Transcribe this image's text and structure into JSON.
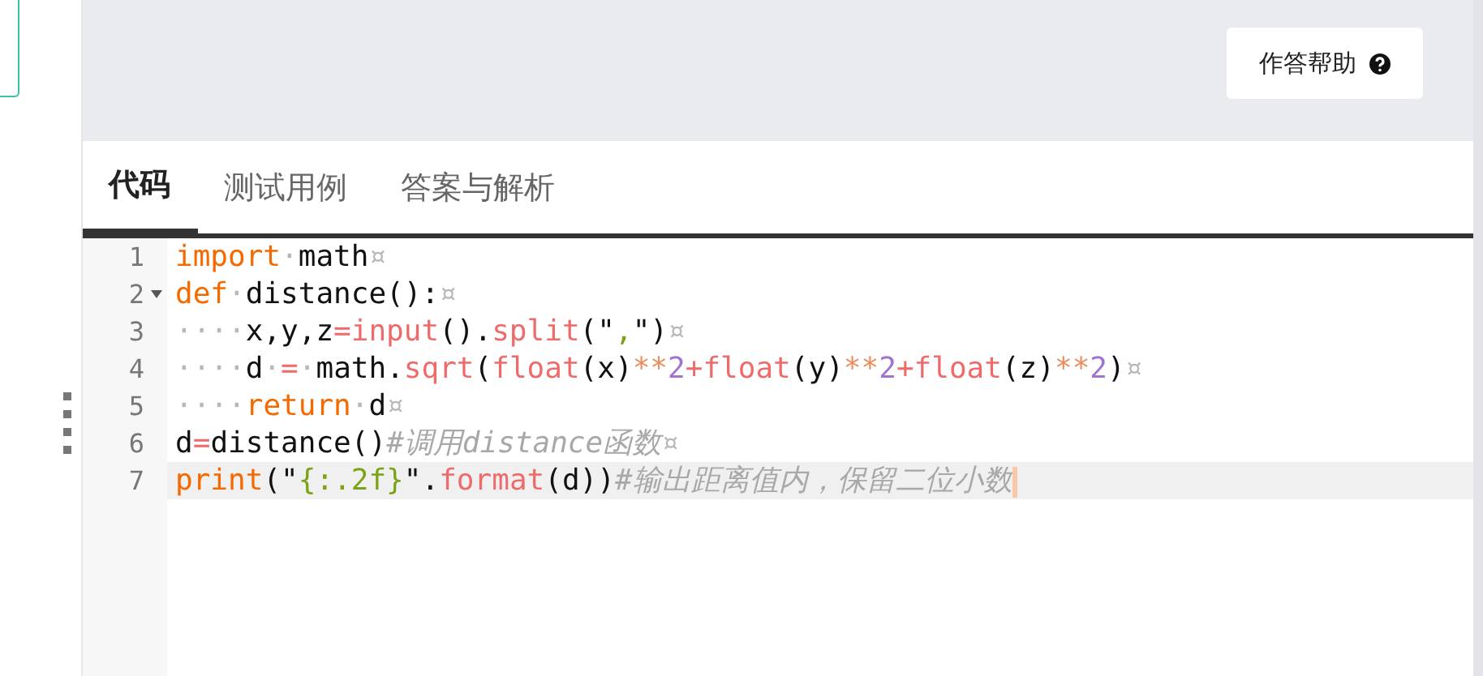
{
  "help_button": {
    "label": "作答帮助"
  },
  "tabs": [
    {
      "label": "代码",
      "selected": true
    },
    {
      "label": "测试用例",
      "selected": false
    },
    {
      "label": "答案与解析",
      "selected": false
    }
  ],
  "editor": {
    "lines": [
      {
        "number": "1",
        "fold": false,
        "active": false,
        "tokens": [
          {
            "kind": "keyword",
            "text": "import"
          },
          {
            "kind": "invisible",
            "text": "·"
          },
          {
            "kind": "plain",
            "text": "math"
          },
          {
            "kind": "invisible",
            "text": "¤"
          }
        ]
      },
      {
        "number": "2",
        "fold": true,
        "active": false,
        "tokens": [
          {
            "kind": "keyword",
            "text": "def"
          },
          {
            "kind": "invisible",
            "text": "·"
          },
          {
            "kind": "plain",
            "text": "distance():"
          },
          {
            "kind": "invisible",
            "text": "¤"
          }
        ]
      },
      {
        "number": "3",
        "fold": false,
        "active": false,
        "tokens": [
          {
            "kind": "invisible",
            "text": "····"
          },
          {
            "kind": "plain",
            "text": "x,y,z"
          },
          {
            "kind": "func",
            "text": "=input"
          },
          {
            "kind": "plain",
            "text": "()."
          },
          {
            "kind": "func",
            "text": "split"
          },
          {
            "kind": "plain",
            "text": "(\""
          },
          {
            "kind": "string",
            "text": ","
          },
          {
            "kind": "plain",
            "text": "\")"
          },
          {
            "kind": "invisible",
            "text": "¤"
          }
        ]
      },
      {
        "number": "4",
        "fold": false,
        "active": false,
        "tokens": [
          {
            "kind": "invisible",
            "text": "····"
          },
          {
            "kind": "plain",
            "text": "d"
          },
          {
            "kind": "invisible",
            "text": "·"
          },
          {
            "kind": "func",
            "text": "="
          },
          {
            "kind": "invisible",
            "text": "·"
          },
          {
            "kind": "plain",
            "text": "math."
          },
          {
            "kind": "func",
            "text": "sqrt"
          },
          {
            "kind": "plain",
            "text": "("
          },
          {
            "kind": "func",
            "text": "float"
          },
          {
            "kind": "plain",
            "text": "(x)"
          },
          {
            "kind": "operator",
            "text": "**"
          },
          {
            "kind": "number",
            "text": "2"
          },
          {
            "kind": "func",
            "text": "+float"
          },
          {
            "kind": "plain",
            "text": "(y)"
          },
          {
            "kind": "operator",
            "text": "**"
          },
          {
            "kind": "number",
            "text": "2"
          },
          {
            "kind": "func",
            "text": "+float"
          },
          {
            "kind": "plain",
            "text": "(z)"
          },
          {
            "kind": "operator",
            "text": "**"
          },
          {
            "kind": "number",
            "text": "2"
          },
          {
            "kind": "plain",
            "text": ")"
          },
          {
            "kind": "invisible",
            "text": "¤"
          }
        ]
      },
      {
        "number": "5",
        "fold": false,
        "active": false,
        "tokens": [
          {
            "kind": "invisible",
            "text": "····"
          },
          {
            "kind": "keyword",
            "text": "return"
          },
          {
            "kind": "invisible",
            "text": "·"
          },
          {
            "kind": "plain",
            "text": "d"
          },
          {
            "kind": "invisible",
            "text": "¤"
          }
        ]
      },
      {
        "number": "6",
        "fold": false,
        "active": false,
        "tokens": [
          {
            "kind": "plain",
            "text": "d"
          },
          {
            "kind": "func",
            "text": "="
          },
          {
            "kind": "plain",
            "text": "distance()"
          },
          {
            "kind": "comment",
            "text": "#调用distance函数"
          },
          {
            "kind": "invisible",
            "text": "¤"
          }
        ]
      },
      {
        "number": "7",
        "fold": false,
        "active": true,
        "tokens": [
          {
            "kind": "keyword",
            "text": "print"
          },
          {
            "kind": "plain",
            "text": "(\""
          },
          {
            "kind": "string",
            "text": "{:.2f}"
          },
          {
            "kind": "plain",
            "text": "\"."
          },
          {
            "kind": "func",
            "text": "format"
          },
          {
            "kind": "plain",
            "text": "(d))"
          },
          {
            "kind": "comment",
            "text": "#输出距离值内，保留二位小数"
          }
        ]
      }
    ]
  }
}
